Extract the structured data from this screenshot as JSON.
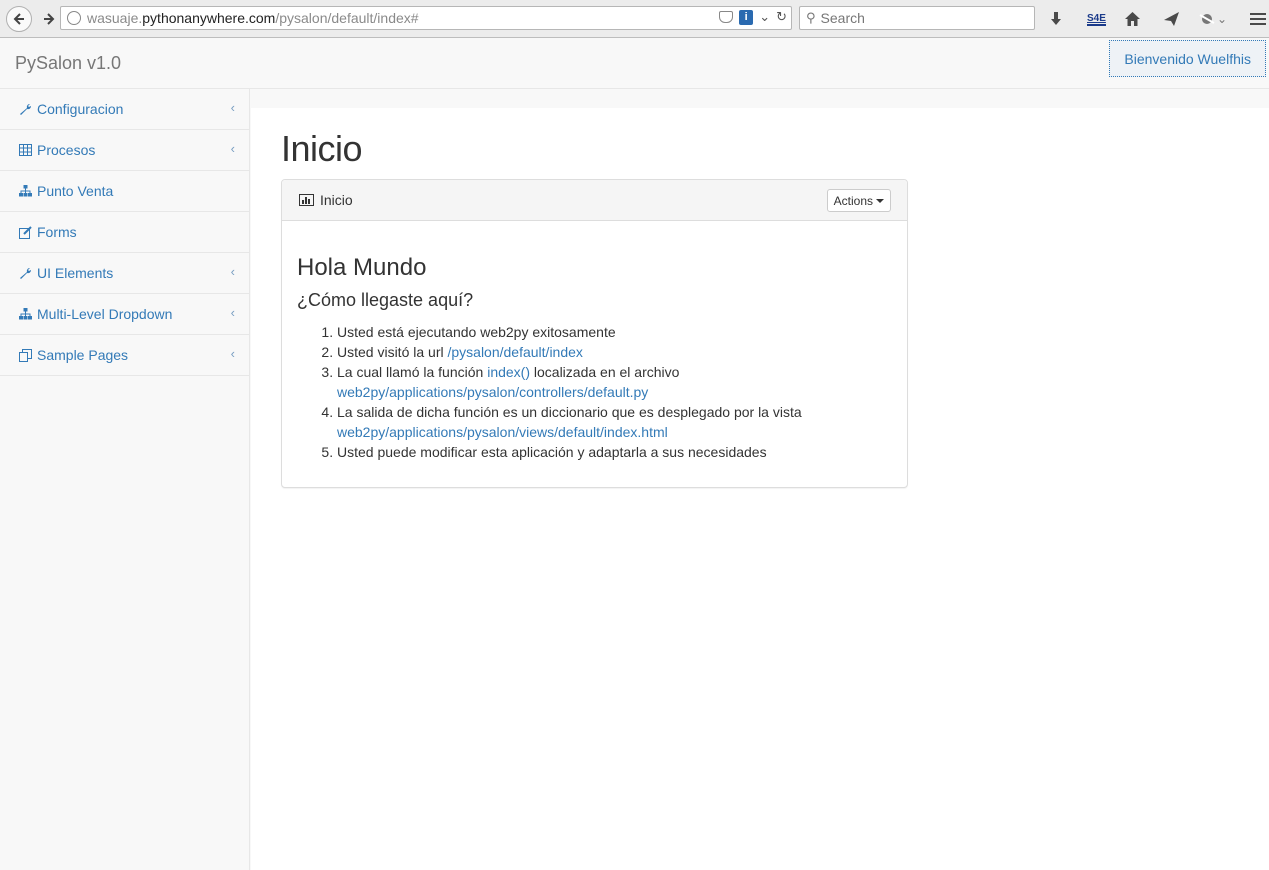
{
  "browser": {
    "url_host_prefix": "wasuaje.",
    "url_host_main": "pythonanywhere.com",
    "url_path": "/pysalon/default/index#",
    "search_placeholder": "Search",
    "s4e_label": "S4E"
  },
  "navbar": {
    "brand": "PySalon v1.0",
    "welcome": "Bienvenido Wuelfhis"
  },
  "sidebar": {
    "items": [
      {
        "label": "Configuracion",
        "icon": "wrench-icon",
        "has_chevron": true
      },
      {
        "label": "Procesos",
        "icon": "table-icon",
        "has_chevron": true
      },
      {
        "label": "Punto Venta",
        "icon": "sitemap-icon",
        "has_chevron": false
      },
      {
        "label": "Forms",
        "icon": "edit-icon",
        "has_chevron": false
      },
      {
        "label": "UI Elements",
        "icon": "wrench-icon",
        "has_chevron": true
      },
      {
        "label": "Multi-Level Dropdown",
        "icon": "sitemap-icon",
        "has_chevron": true
      },
      {
        "label": "Sample Pages",
        "icon": "files-icon",
        "has_chevron": true
      }
    ]
  },
  "main": {
    "page_title": "Inicio",
    "panel": {
      "title": "Inicio",
      "actions_label": "Actions",
      "heading": "Hola Mundo",
      "subheading": "¿Cómo llegaste aquí?",
      "steps": {
        "s1": "Usted está ejecutando web2py exitosamente",
        "s2_text": "Usted visitó la url ",
        "s2_link": "/pysalon/default/index",
        "s3_text1": "La cual llamó la función ",
        "s3_link1": "index()",
        "s3_text2": " localizada en el archivo ",
        "s3_link2": "web2py/applications/pysalon/controllers/default.py",
        "s4_text": "La salida de dicha función es un diccionario que es desplegado por la vista ",
        "s4_link": "web2py/applications/pysalon/views/default/index.html",
        "s5": "Usted puede modificar esta aplicación y adaptarla a sus necesidades"
      }
    }
  },
  "colors": {
    "link": "#337ab7",
    "navbar_bg": "#f8f8f8",
    "border": "#e7e7e7"
  }
}
